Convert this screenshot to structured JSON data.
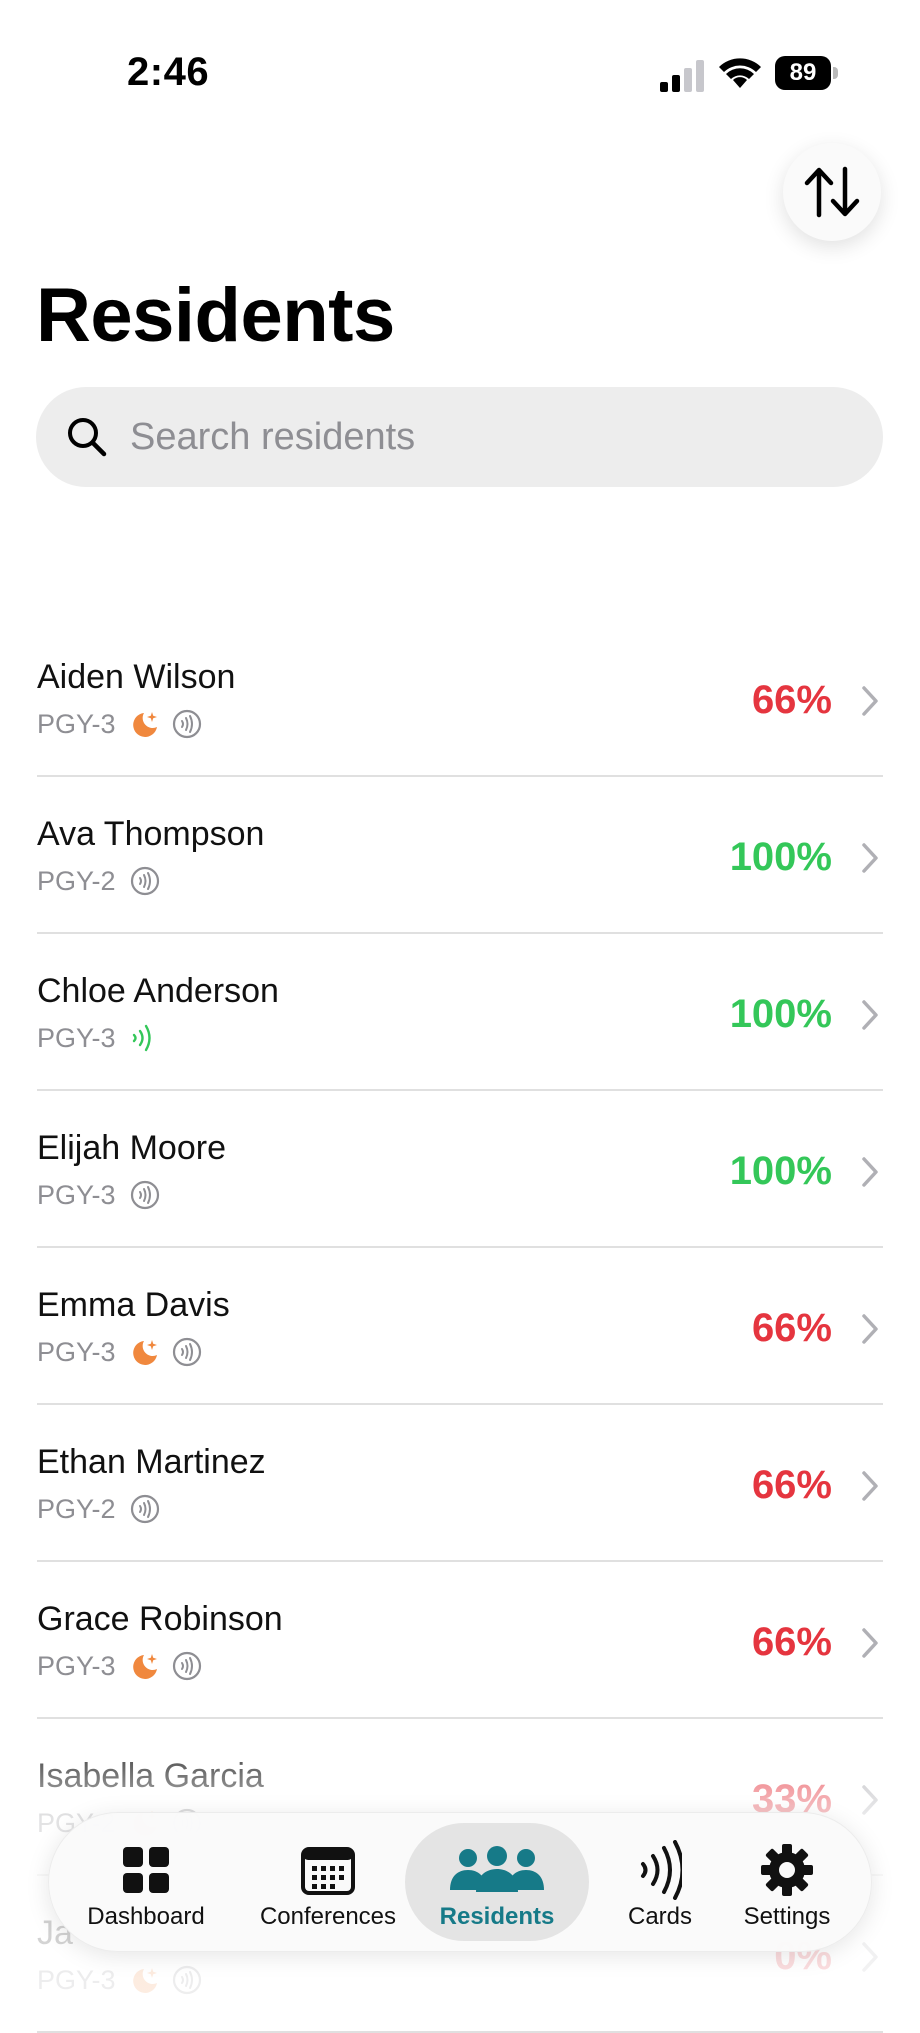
{
  "status_bar": {
    "time": "2:46",
    "battery": "89"
  },
  "page_title": "Residents",
  "search": {
    "placeholder": "Search residents"
  },
  "colors": {
    "accent": "#167a88",
    "low": "#e5353f",
    "full": "#34c759",
    "night": "#f0883e"
  },
  "residents": [
    {
      "name": "Aiden Wilson",
      "pgy": "PGY-3",
      "icons": [
        "night-call-icon",
        "nfc-icon"
      ],
      "percent": "66%",
      "status": "low"
    },
    {
      "name": "Ava Thompson",
      "pgy": "PGY-2",
      "icons": [
        "nfc-icon"
      ],
      "percent": "100%",
      "status": "full"
    },
    {
      "name": "Chloe Anderson",
      "pgy": "PGY-3",
      "icons": [
        "nfc-active-icon"
      ],
      "percent": "100%",
      "status": "full"
    },
    {
      "name": "Elijah Moore",
      "pgy": "PGY-3",
      "icons": [
        "nfc-icon"
      ],
      "percent": "100%",
      "status": "full"
    },
    {
      "name": "Emma Davis",
      "pgy": "PGY-3",
      "icons": [
        "night-call-icon",
        "nfc-icon"
      ],
      "percent": "66%",
      "status": "low"
    },
    {
      "name": "Ethan Martinez",
      "pgy": "PGY-2",
      "icons": [
        "nfc-icon"
      ],
      "percent": "66%",
      "status": "low"
    },
    {
      "name": "Grace Robinson",
      "pgy": "PGY-3",
      "icons": [
        "night-call-icon",
        "nfc-icon"
      ],
      "percent": "66%",
      "status": "low"
    },
    {
      "name": "Isabella Garcia",
      "pgy": "PGY-2",
      "icons": [
        "night-call-icon",
        "nfc-icon"
      ],
      "percent": "33%",
      "status": "low"
    },
    {
      "name": "Ja",
      "pgy": "PGY-3",
      "icons": [
        "night-call-icon",
        "nfc-icon"
      ],
      "percent": "0%",
      "status": "low"
    }
  ],
  "tabs": [
    {
      "label": "Dashboard",
      "icon": "grid-icon",
      "active": false
    },
    {
      "label": "Conferences",
      "icon": "calendar-icon",
      "active": false
    },
    {
      "label": "Residents",
      "icon": "people-icon",
      "active": true
    },
    {
      "label": "Cards",
      "icon": "nfc-waves-icon",
      "active": false
    },
    {
      "label": "Settings",
      "icon": "gear-icon",
      "active": false
    }
  ]
}
